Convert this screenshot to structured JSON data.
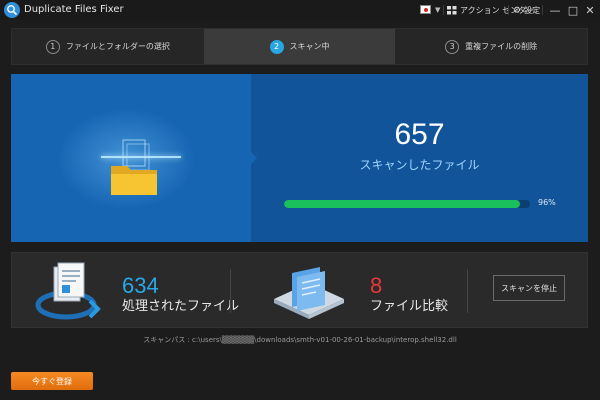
{
  "window": {
    "title": "Duplicate Files Fixer",
    "language_icon": "japan-flag-icon",
    "action_center_label": "アクション センター",
    "settings_label": "設定",
    "minimize_glyph": "—",
    "maximize_glyph": "□",
    "close_glyph": "✕"
  },
  "steps": [
    {
      "number": "1",
      "label": "ファイルとフォルダーの選択",
      "active": false
    },
    {
      "number": "2",
      "label": "スキャン中",
      "active": true
    },
    {
      "number": "3",
      "label": "重複ファイルの削除",
      "active": false
    }
  ],
  "scan": {
    "scanned_count": "657",
    "scanned_caption": "スキャンしたファイル",
    "progress_percent": 96,
    "progress_label": "96%"
  },
  "stats": {
    "processed_count": "634",
    "processed_label": "処理されたファイル",
    "compare_count": "8",
    "compare_label": "ファイル比較",
    "stop_button": "スキャンを停止"
  },
  "scan_path": "スキャンパス : c:\\users\\▒▒▒▒▒▒\\downloads\\smth-v01-00-26-01-backup\\interop.shell32.dll",
  "register_button": "今すぐ登録",
  "colors": {
    "accent_blue": "#28a8e6",
    "panel_blue": "#1665b3",
    "progress_green": "#19c05b",
    "compare_red": "#e8363a",
    "register_orange": "#f68a22"
  }
}
